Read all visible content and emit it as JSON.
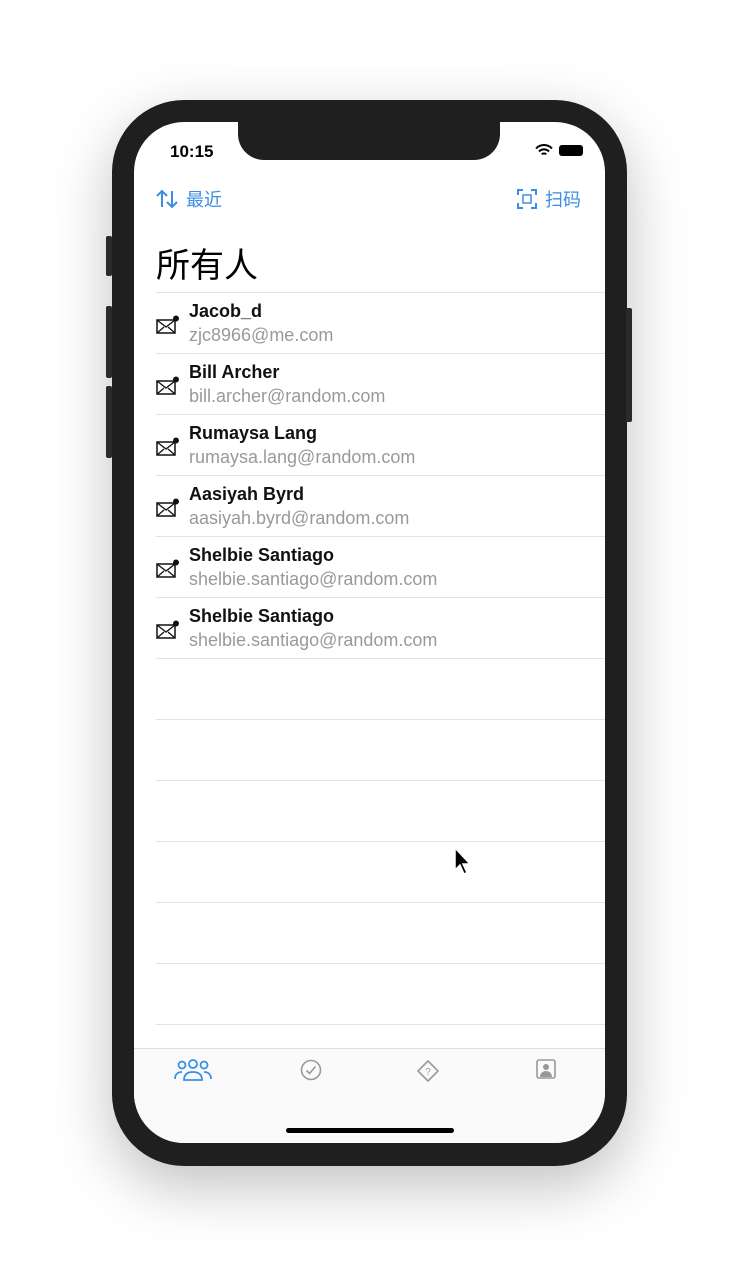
{
  "status_bar": {
    "time": "10:15"
  },
  "nav": {
    "sort_label": "最近",
    "scan_label": "扫码",
    "accent": "#3a8ee6"
  },
  "page_title": "所有人",
  "contacts": [
    {
      "name": "Jacob_d",
      "email": "zjc8966@me.com"
    },
    {
      "name": "Bill Archer",
      "email": "bill.archer@random.com"
    },
    {
      "name": "Rumaysa Lang",
      "email": "rumaysa.lang@random.com"
    },
    {
      "name": "Aasiyah Byrd",
      "email": "aasiyah.byrd@random.com"
    },
    {
      "name": "Shelbie Santiago",
      "email": "shelbie.santiago@random.com"
    },
    {
      "name": "Shelbie Santiago",
      "email": "shelbie.santiago@random.com"
    }
  ],
  "tabs": [
    {
      "icon": "people-icon",
      "active": true
    },
    {
      "icon": "checkmark-circle-icon",
      "active": false
    },
    {
      "icon": "question-diamond-icon",
      "active": false
    },
    {
      "icon": "contact-card-icon",
      "active": false
    }
  ]
}
